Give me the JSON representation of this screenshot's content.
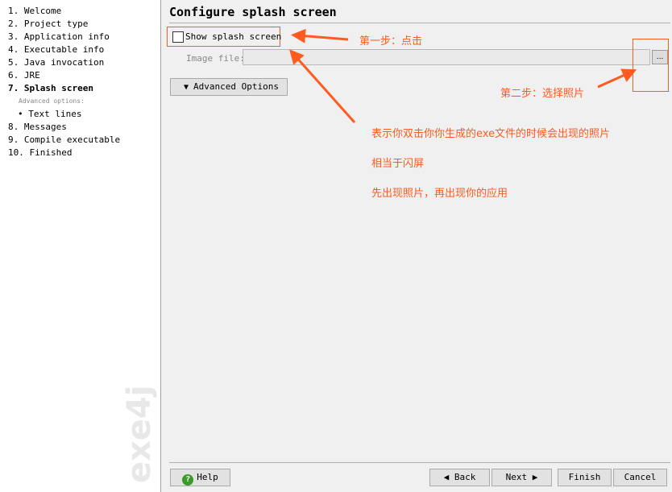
{
  "sidebar": {
    "steps": [
      "1. Welcome",
      "2. Project type",
      "3. Application info",
      "4. Executable info",
      "5. Java invocation",
      "6. JRE",
      "7. Splash screen",
      "8. Messages",
      "9. Compile executable",
      "10. Finished"
    ],
    "sub_heading": "Advanced options:",
    "sub_item": "• Text lines",
    "logo": "exe4j"
  },
  "main": {
    "title": "Configure splash screen",
    "show_splash_label": "Show splash screen",
    "show_splash_checked": false,
    "image_file_label": "Image file:",
    "image_file_value": "",
    "browse_label": "...",
    "advanced_label": "Advanced Options"
  },
  "annotations": {
    "step1": "第一步：点击",
    "step2": "第二步：选择照片",
    "note1": "表示你双击你你生成的exe文件的时候会出现的照片",
    "note2": "相当于闪屏",
    "note3": "先出现照片，再出现你的应用",
    "color": "#ff5a1f"
  },
  "buttons": {
    "help": "Help",
    "back": "Back",
    "next": "Next",
    "finish": "Finish",
    "cancel": "Cancel"
  }
}
